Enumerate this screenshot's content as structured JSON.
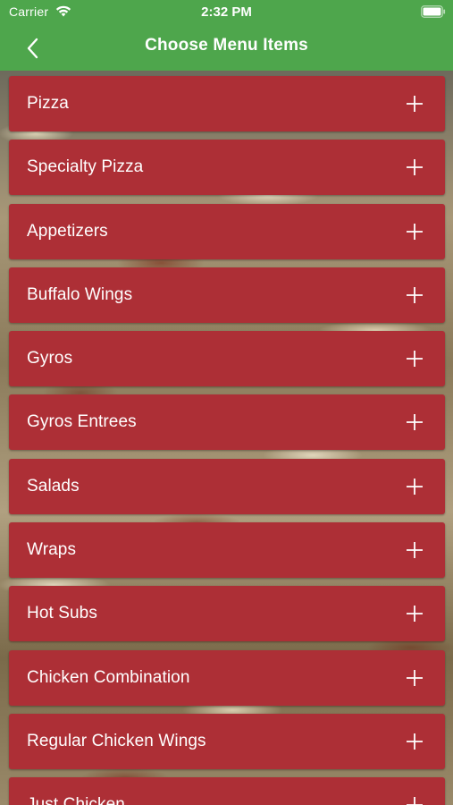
{
  "status_bar": {
    "carrier": "Carrier",
    "time": "2:32 PM",
    "wifi_icon": "wifi-icon",
    "battery_icon": "battery-icon"
  },
  "nav_bar": {
    "title": "Choose Menu Items",
    "back_icon": "chevron-left-icon",
    "background_color": "#4ea64c"
  },
  "menu": {
    "item_color": "#ad2f36",
    "expand_icon": "plus-icon",
    "items": [
      {
        "label": "Pizza"
      },
      {
        "label": "Specialty Pizza"
      },
      {
        "label": "Appetizers"
      },
      {
        "label": "Buffalo Wings"
      },
      {
        "label": "Gyros"
      },
      {
        "label": "Gyros Entrees"
      },
      {
        "label": "Salads"
      },
      {
        "label": "Wraps"
      },
      {
        "label": "Hot Subs"
      },
      {
        "label": "Chicken Combination"
      },
      {
        "label": "Regular Chicken Wings"
      },
      {
        "label": "Just Chicken"
      }
    ]
  }
}
